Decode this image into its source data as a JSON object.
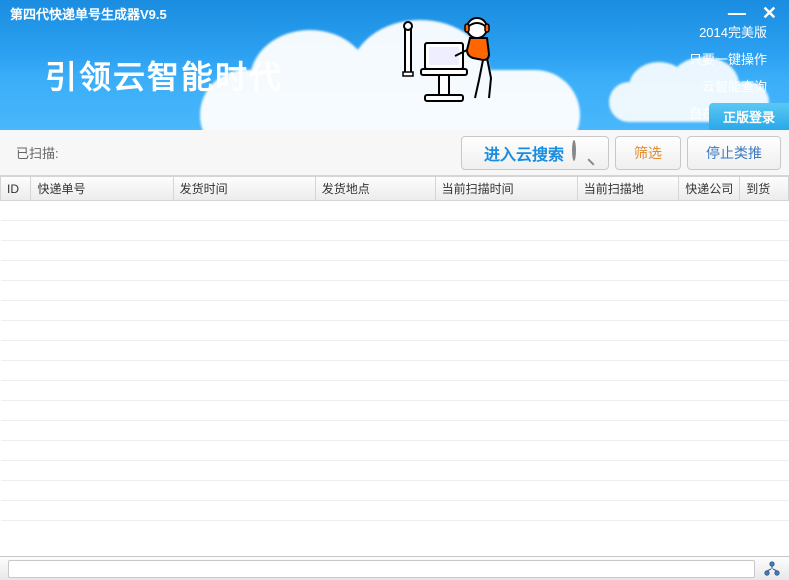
{
  "app": {
    "title": "第四代快递单号生成器V9.5",
    "banner": "引领云智能时代"
  },
  "features": {
    "f1": "2014完美版",
    "f2": "只要一键操作",
    "f3": "云智能查询",
    "f4": "自在随心乐享"
  },
  "login_btn": "正版登录",
  "toolbar": {
    "scanned_label": "已扫描:",
    "search_btn": "进入云搜索",
    "filter_btn": "筛选",
    "stop_btn": "停止类推"
  },
  "columns": {
    "c0": "ID",
    "c1": "快递单号",
    "c2": "发货时间",
    "c3": "发货地点",
    "c4": "当前扫描时间",
    "c5": "当前扫描地",
    "c6": "快递公司",
    "c7": "到货"
  },
  "col_widths": [
    "30px",
    "140px",
    "140px",
    "118px",
    "140px",
    "100px",
    "60px",
    "48px"
  ],
  "empty_rows": 16,
  "colors": {
    "header_blue": "#2b9ff0",
    "primary_blue": "#1a8de0",
    "orange": "#e08a2a"
  }
}
